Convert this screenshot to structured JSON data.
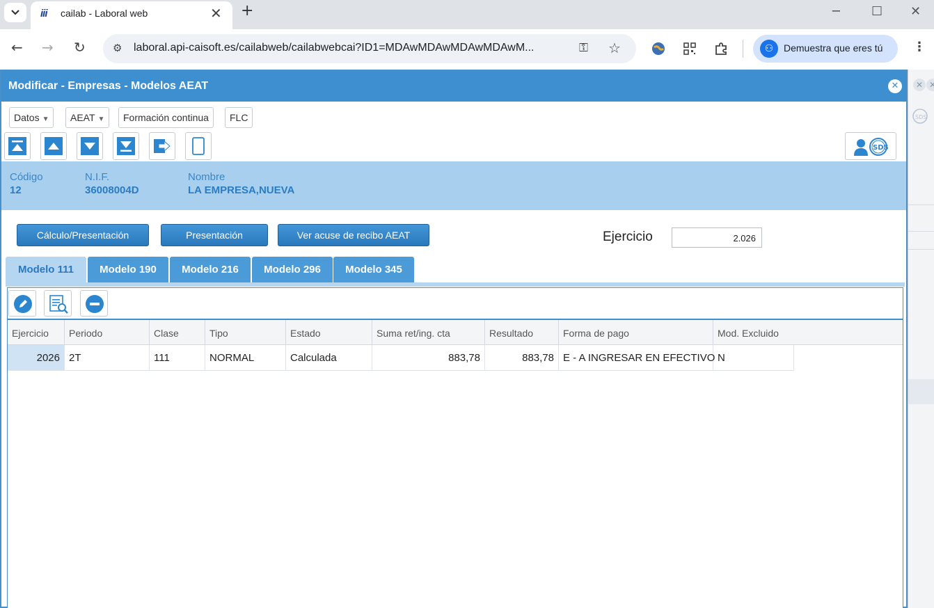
{
  "browser": {
    "tab_title": "cailab - Laboral web",
    "favicon_text": "iii",
    "url": "laboral.api-caisoft.es/cailabweb/cailabwebcai?ID1=MDAwMDAwMDAwMDAwM...",
    "profile_label": "Demuestra que eres tú"
  },
  "window": {
    "title": "Modificar - Empresas - Modelos AEAT"
  },
  "menu": {
    "datos": "Datos",
    "aeat": "AEAT",
    "formacion": "Formación continua",
    "flc": "FLC"
  },
  "company": {
    "codigo_label": "Código",
    "codigo_value": "12",
    "nif_label": "N.I.F.",
    "nif_value": "36008004D",
    "nombre_label": "Nombre",
    "nombre_value": "LA EMPRESA,NUEVA"
  },
  "actions": {
    "calculo": "Cálculo/Presentación",
    "presentacion": "Presentación",
    "acuse": "Ver acuse de recibo AEAT"
  },
  "ejercicio": {
    "label": "Ejercicio",
    "value": "2.026"
  },
  "tabs": [
    {
      "label": "Modelo 111",
      "active": true
    },
    {
      "label": "Modelo 190",
      "active": false
    },
    {
      "label": "Modelo 216",
      "active": false
    },
    {
      "label": "Modelo 296",
      "active": false
    },
    {
      "label": "Modelo 345",
      "active": false
    }
  ],
  "table": {
    "columns": [
      "Ejercicio",
      "Periodo",
      "Clase",
      "Tipo",
      "Estado",
      "Suma ret/ing. cta",
      "Resultado",
      "Forma de pago",
      "Mod. Excluido"
    ],
    "rows": [
      [
        "2026",
        "2T",
        "111",
        "NORMAL",
        "Calculada",
        "883,78",
        "883,78",
        "E - A INGRESAR EN EFECTIVO",
        "N"
      ]
    ]
  },
  "colors": {
    "titlebar": "#3d8fd0",
    "info_band": "#a8d0ee",
    "tab": "#4a9bd8",
    "tab_active": "#b4d6f0",
    "selected_cell": "#cfe3f5"
  }
}
